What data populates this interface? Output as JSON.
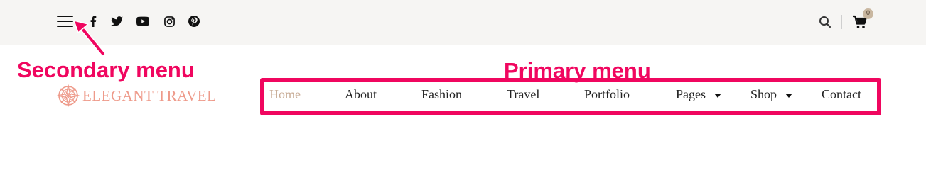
{
  "topbar": {
    "menu_icon": "hamburger-icon",
    "social_icons": [
      "facebook-icon",
      "twitter-icon",
      "youtube-icon",
      "instagram-icon",
      "pinterest-icon"
    ],
    "search_icon": "search-icon",
    "cart_icon": "cart-icon",
    "cart_count": "0"
  },
  "annotations": {
    "secondary": "Secondary menu",
    "primary": "Primary menu",
    "color": "#f0065f"
  },
  "logo": {
    "text": "ELEGANT TRAVEL",
    "icon": "compass-icon",
    "color": "#ee9a8a"
  },
  "nav": {
    "items": [
      {
        "label": "Home",
        "active": true
      },
      {
        "label": "About"
      },
      {
        "label": "Fashion"
      },
      {
        "label": "Travel"
      },
      {
        "label": "Portfolio"
      },
      {
        "label": "Pages",
        "dropdown": true
      },
      {
        "label": "Shop",
        "dropdown": true
      },
      {
        "label": "Contact"
      }
    ],
    "active_color": "#c9ad97"
  }
}
